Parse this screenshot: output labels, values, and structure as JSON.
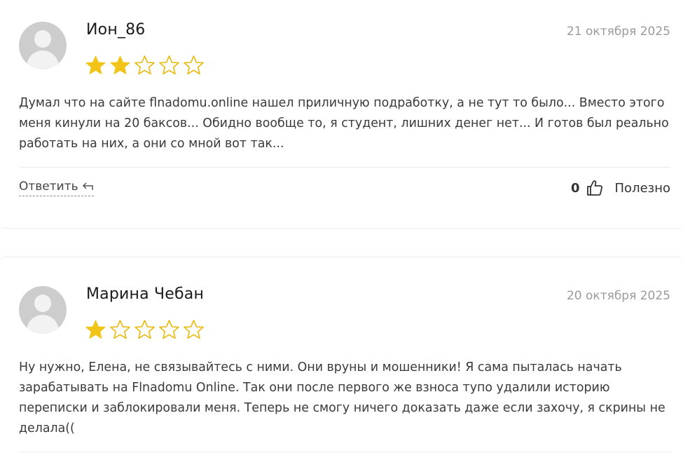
{
  "reviews": [
    {
      "author": "Ион_86",
      "date": "21 октября 2025",
      "rating": 2,
      "max_rating": 5,
      "text": "Думал что на сайте flnadomu.online нашел приличную подработку, а не тут то было... Вместо этого меня кинули на 20 баксов... Обидно вообще то, я студент, лишних денег нет... И готов был реально работать на них, а они со мной вот так...",
      "reply_label": "Ответить",
      "useful_count": "0",
      "useful_label": "Полезно"
    },
    {
      "author": "Марина Чебан",
      "date": "20 октября 2025",
      "rating": 1,
      "max_rating": 5,
      "text": "Ну нужно, Елена, не связывайтесь с ними. Они вруны и мошенники! Я сама пыталась начать зарабатывать на Flnadomu Online. Так они после первого же взноса тупо удалили историю переписки и заблокировали меня. Теперь не смогу ничего доказать даже если захочу, я скрины не делала(("
    }
  ],
  "colors": {
    "star_filled": "#f2c418",
    "star_empty_stroke": "#e8b90e",
    "avatar_bg": "#cdcdcd"
  },
  "icons": {
    "avatar": "user-avatar-icon",
    "star": "star-icon",
    "reply": "reply-arrow-icon",
    "thumb": "thumbs-up-icon"
  }
}
